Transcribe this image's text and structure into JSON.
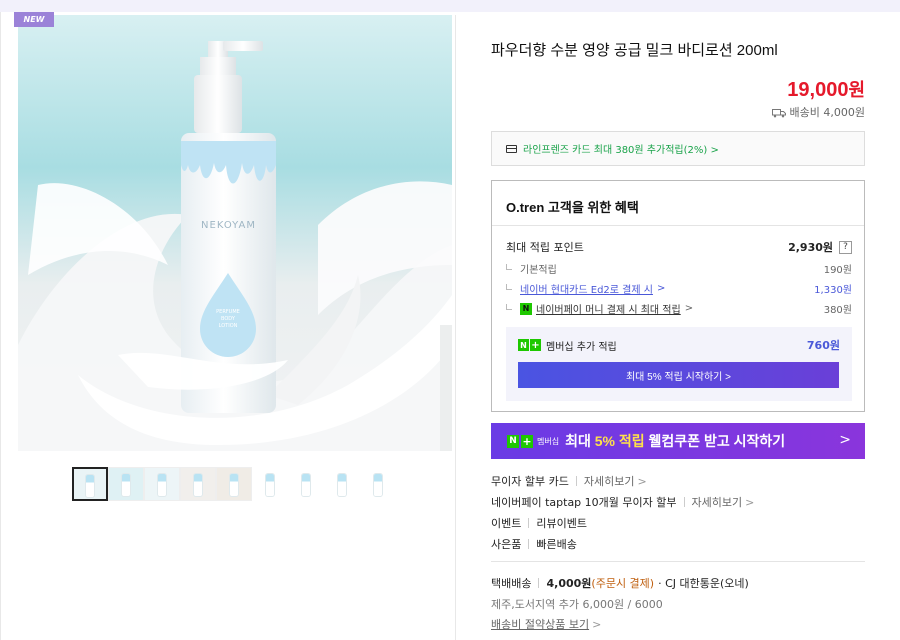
{
  "badge": "NEW",
  "product": {
    "title": "파우더향 수분 영양 공급 밀크 바디로션 200ml",
    "price": "19,000",
    "price_unit": "원",
    "shipping_fee": "배송비 4,000원",
    "brand_on_bottle": "NEKOYAM",
    "drop_label_lines": [
      "PERFUME",
      "BODY",
      "LOTION"
    ]
  },
  "thumbnails": {
    "count": 9,
    "active_index": 0
  },
  "card_promo": "라인프렌즈 카드 최대 380원 추가적립(2%) >",
  "benefits": {
    "title": "O.tren 고객을 위한 혜택",
    "max_points_label": "최대 적립 포인트",
    "max_points_value": "2,930원",
    "help": "?",
    "rows": [
      {
        "label": "기본적립",
        "value": "190원"
      },
      {
        "label": "네이버 현대카드 Ed2로 결제 시",
        "chev": ">",
        "value": "1,330원"
      },
      {
        "label": "네이버페이 머니 결제 시 최대 적립",
        "chev": ">",
        "value": "380원"
      }
    ],
    "npay_icon": "N",
    "membership_label": "멤버십 추가 적립",
    "membership_value": "760원",
    "membership_button": "최대 5% 적립 시작하기 >"
  },
  "banner": {
    "tag_n": "N",
    "tag_plus": "+",
    "tag_text": "멤버십",
    "text_before": "최대 ",
    "text_highlight": "5% 적립",
    "text_after": " 웰컴쿠폰 받고 시작하기",
    "chev": ">"
  },
  "info": {
    "installment_label": "무이자 할부 카드",
    "installment_link": "자세히보기",
    "taptap_label": "네이버페이 taptap 10개월 무이자 할부",
    "taptap_link": "자세히보기",
    "event_label": "이벤트",
    "event_value": "리뷰이벤트",
    "gift_label": "사은품",
    "gift_value": "빠른배송",
    "chev": ">"
  },
  "delivery": {
    "method": "택배배송",
    "fee": "4,000원",
    "fee_note": "(주문시 결제)",
    "carrier": "· CJ 대한통운(오네)",
    "island": "제주,도서지역 추가 6,000원 / 6000",
    "save_link": "배송비 절약상품 보기",
    "chev": ">"
  },
  "colors": {
    "price_red": "#e5192b",
    "accent_purple": "#7a3ae0",
    "naver_green": "#1ec800",
    "link_blue": "#4a58d8"
  }
}
